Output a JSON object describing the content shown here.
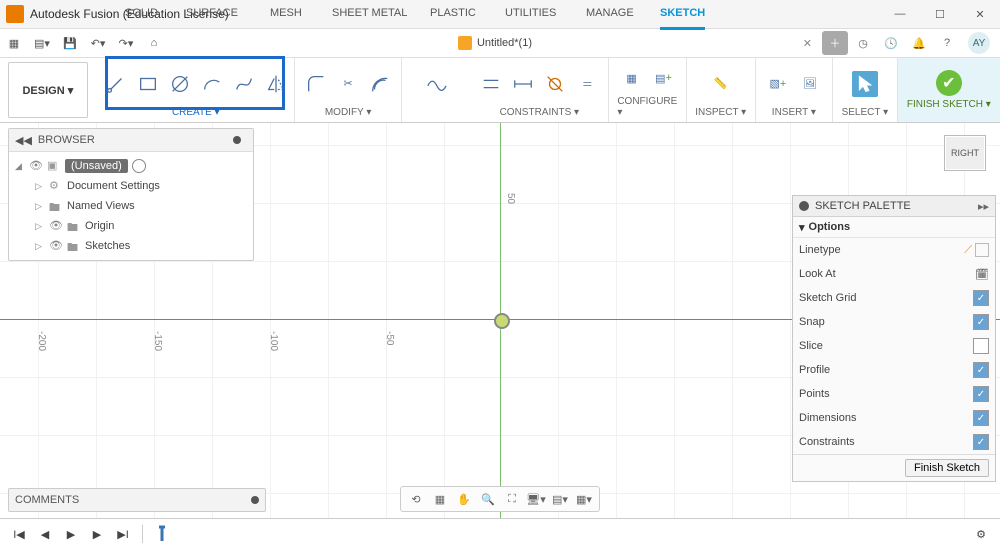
{
  "titlebar": {
    "title": "Autodesk Fusion (Education License)"
  },
  "doc": {
    "name": "Untitled*(1)"
  },
  "avatar": "AY",
  "ribbon_tabs": {
    "solid": "SOLID",
    "surface": "SURFACE",
    "mesh": "MESH",
    "sheet": "SHEET METAL",
    "plastic": "PLASTIC",
    "utilities": "UTILITIES",
    "manage": "MANAGE",
    "sketch": "SKETCH"
  },
  "design_btn": "DESIGN ▾",
  "panels": {
    "create": "CREATE ▾",
    "modify": "MODIFY ▾",
    "constraints": "CONSTRAINTS ▾",
    "configure": "CONFIGURE ▾",
    "inspect": "INSPECT ▾",
    "insert": "INSERT ▾",
    "select": "SELECT ▾",
    "finish": "FINISH SKETCH ▾"
  },
  "browser": {
    "title": "BROWSER",
    "root": "(Unsaved)",
    "items": {
      "doc": "Document Settings",
      "named": "Named Views",
      "origin": "Origin",
      "sketches": "Sketches"
    }
  },
  "palette": {
    "title": "SKETCH PALETTE",
    "section": "Options",
    "rows": {
      "linetype": "Linetype",
      "lookat": "Look At",
      "grid": "Sketch Grid",
      "snap": "Snap",
      "slice": "Slice",
      "profile": "Profile",
      "points": "Points",
      "dimensions": "Dimensions",
      "constraints": "Constraints"
    },
    "finish": "Finish Sketch"
  },
  "comments": "COMMENTS",
  "viewcube": "RIGHT",
  "axis": {
    "m200": "-200",
    "m150": "-150",
    "m100": "-100",
    "m50": "-50",
    "y50": "50"
  }
}
